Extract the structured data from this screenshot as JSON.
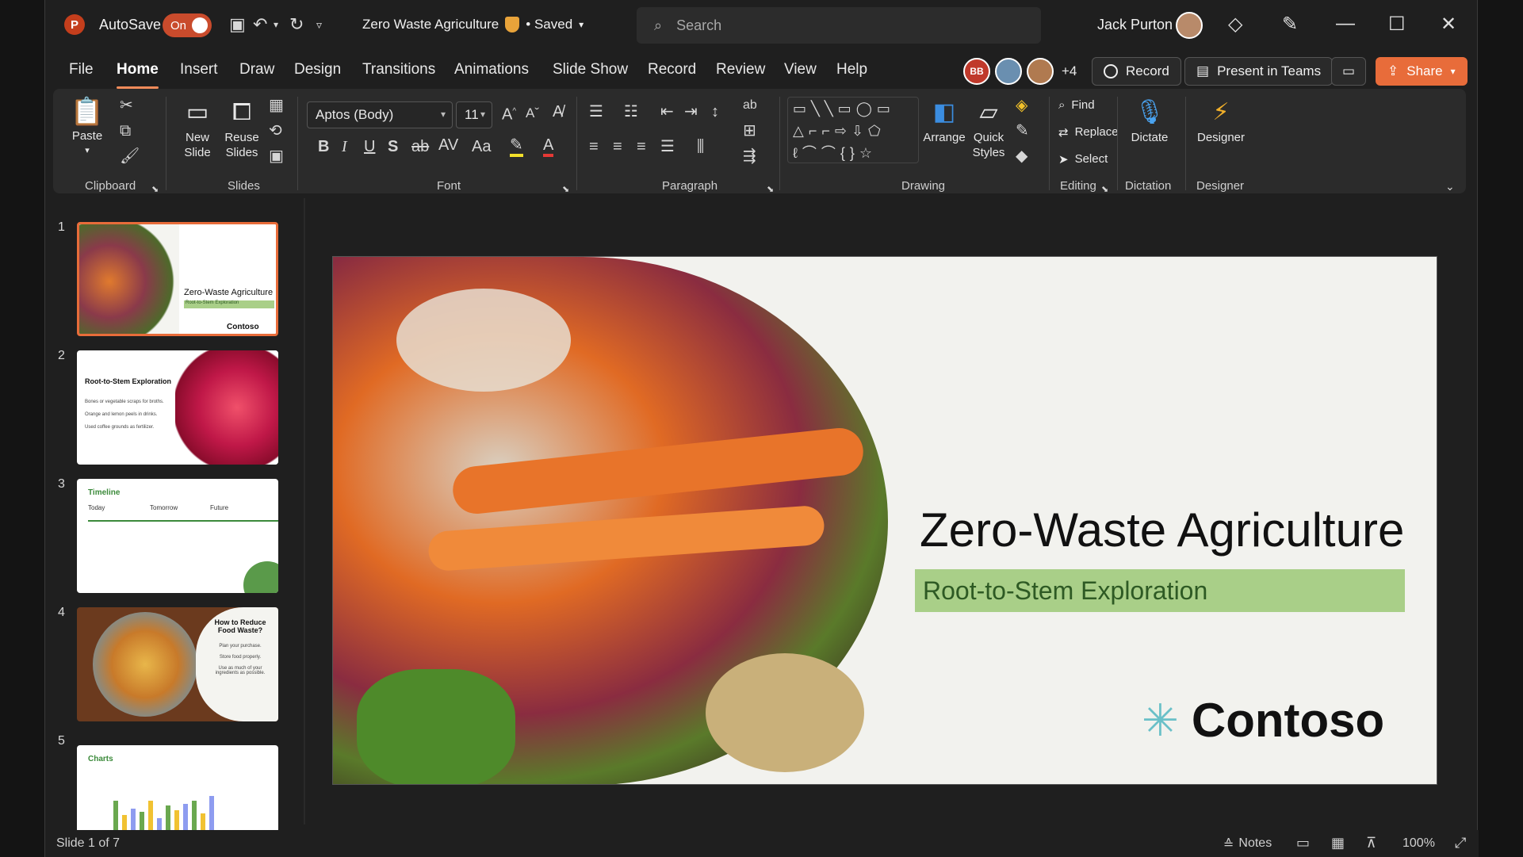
{
  "titlebar": {
    "app_logo": "P",
    "autosave_label": "AutoSave",
    "autosave_state": "On",
    "doc_title": "Zero Waste Agriculture",
    "saved_status": "• Saved",
    "search_placeholder": "Search",
    "user_name": "Jack Purton"
  },
  "menu": {
    "tabs": [
      "File",
      "Home",
      "Insert",
      "Draw",
      "Design",
      "Transitions",
      "Animations",
      "Slide Show",
      "Record",
      "Review",
      "View",
      "Help"
    ],
    "active_tab": "Home",
    "collab_initials": "BB",
    "collab_more": "+4",
    "record_label": "Record",
    "present_label": "Present in Teams",
    "share_label": "Share"
  },
  "ribbon": {
    "clipboard": {
      "paste": "Paste",
      "group": "Clipboard"
    },
    "slides": {
      "new_slide_1": "New",
      "new_slide_2": "Slide",
      "reuse_1": "Reuse",
      "reuse_2": "Slides",
      "group": "Slides"
    },
    "font": {
      "family": "Aptos (Body)",
      "size": "11",
      "group": "Font"
    },
    "paragraph": {
      "group": "Paragraph"
    },
    "drawing": {
      "arrange": "Arrange",
      "quick_1": "Quick",
      "quick_2": "Styles",
      "group": "Drawing"
    },
    "editing": {
      "find": "Find",
      "replace": "Replace",
      "select": "Select",
      "group": "Editing"
    },
    "dictation": {
      "dictate": "Dictate",
      "group": "Dictation"
    },
    "designer": {
      "designer": "Designer",
      "group": "Designer"
    }
  },
  "thumbnails": [
    {
      "num": "1",
      "title": "Zero-Waste Agriculture",
      "subtitle": "Root-to-Stem Exploration",
      "brand": "Contoso"
    },
    {
      "num": "2",
      "title": "Root-to-Stem Exploration",
      "lines": [
        "Bones or vegetable scraps for broths.",
        "Orange and lemon peels in drinks.",
        "Used coffee grounds as fertilizer."
      ]
    },
    {
      "num": "3",
      "title": "Timeline",
      "cols": [
        "Today",
        "Tomorrow",
        "Future"
      ]
    },
    {
      "num": "4",
      "title": "How to Reduce Food Waste?",
      "lines": [
        "Plan your purchase.",
        "Store food properly.",
        "Use as much of your ingredients as possible."
      ]
    },
    {
      "num": "5",
      "title": "Charts"
    }
  ],
  "slide": {
    "title": "Zero-Waste Agriculture",
    "subtitle": "Root-to-Stem Exploration",
    "brand": "Contoso"
  },
  "status": {
    "slide_info": "Slide 1 of 7",
    "notes": "Notes",
    "zoom": "100%"
  },
  "colors": {
    "accent": "#e86c3a",
    "subtitle_bg": "#a9cf88",
    "subtitle_text": "#2e5a24"
  }
}
